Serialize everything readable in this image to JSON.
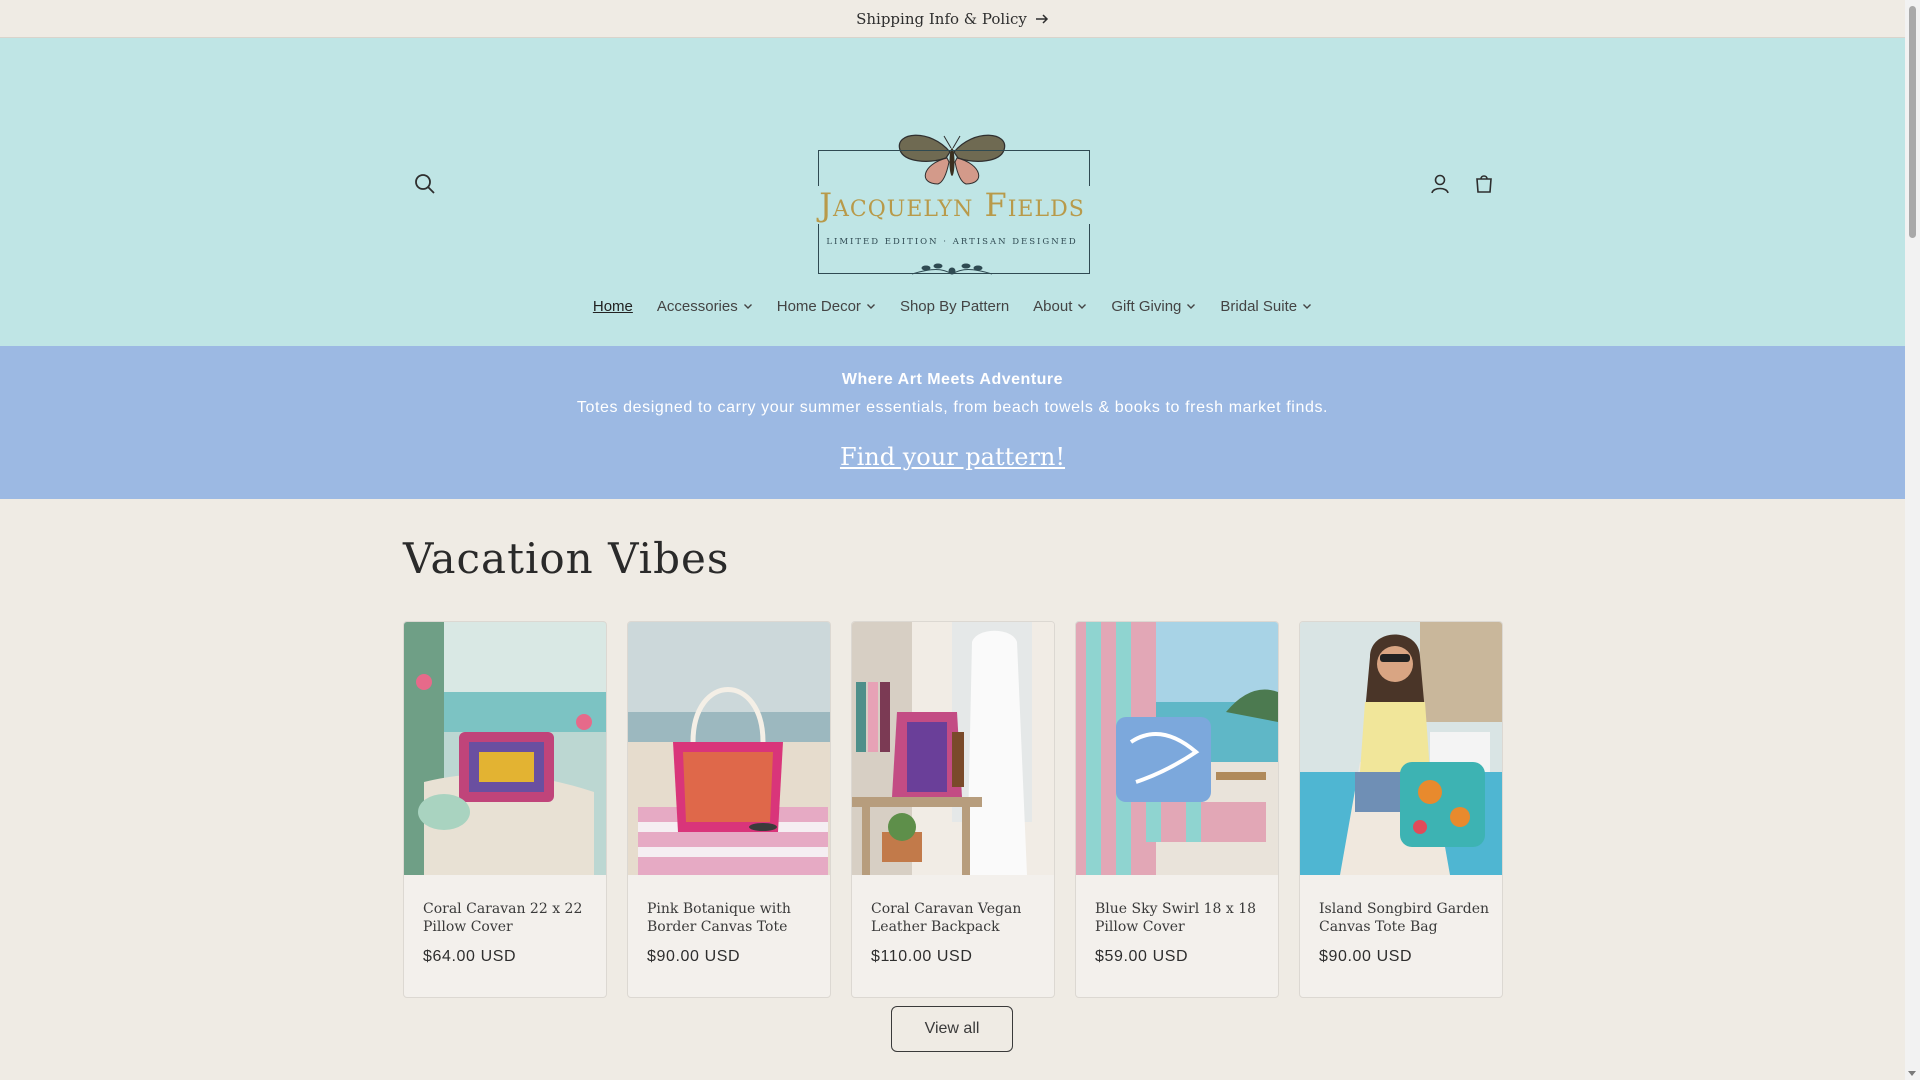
{
  "announcement": {
    "text": "Shipping Info & Policy"
  },
  "header": {
    "brand_name": "Jacquelyn Fields",
    "brand_tagline": "LIMITED EDITION · ARTISAN DESIGNED",
    "background": "#bfe5e5"
  },
  "nav": {
    "items": [
      {
        "label": "Home",
        "active": true,
        "has_menu": false
      },
      {
        "label": "Accessories",
        "has_menu": true
      },
      {
        "label": "Home Decor",
        "has_menu": true
      },
      {
        "label": "Shop By Pattern",
        "has_menu": false
      },
      {
        "label": "About",
        "has_menu": true
      },
      {
        "label": "Gift Giving",
        "has_menu": true
      },
      {
        "label": "Bridal Suite",
        "has_menu": true
      }
    ]
  },
  "banner": {
    "heading": "Where Art Meets Adventure",
    "text": "Totes designed to carry your summer essentials, from beach towels & books to fresh market finds.",
    "link": "Find your pattern!",
    "background": "#9cb9e3"
  },
  "collection": {
    "title": "Vacation Vibes",
    "products": [
      {
        "title": "Coral Caravan 22 x 22 Pillow Cover",
        "price": "$64.00 USD"
      },
      {
        "title": "Pink Botanique with Border Canvas Tote",
        "price": "$90.00 USD"
      },
      {
        "title": "Coral Caravan Vegan Leather Backpack",
        "price": "$110.00 USD"
      },
      {
        "title": "Blue Sky Swirl 18 x 18 Pillow Cover",
        "price": "$59.00 USD"
      },
      {
        "title": "Island Songbird Garden Canvas Tote Bag",
        "price": "$90.00 USD"
      }
    ],
    "view_all_label": "View all"
  }
}
